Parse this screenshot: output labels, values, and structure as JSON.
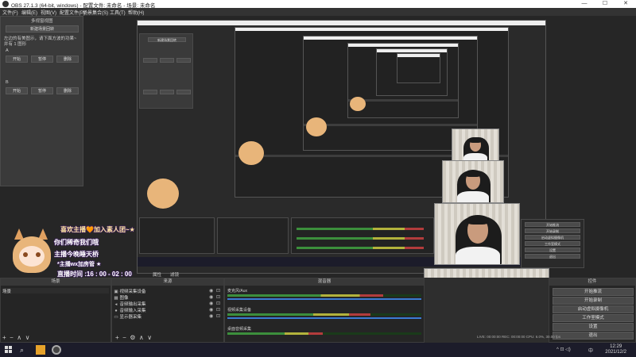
{
  "window": {
    "title": "OBS 27.1.3 (64-bit, windows) - 配置文件: 未命名 - 场景: 未命名",
    "controls": {
      "minimize": "—",
      "maximize": "☐",
      "close": "✕"
    }
  },
  "menu": [
    "文件(F)",
    "编辑(E)",
    "视图(V)",
    "配置文件(P)",
    "场景集合(S)",
    "工具(T)",
    "帮助(H)"
  ],
  "left_panel": {
    "header": "多视窗视图",
    "inner_button": "新建场景回转",
    "info_text": "左边的有美图示，请下面方波的功果~",
    "info_text2": "并有 1 图形",
    "section1": "A",
    "section2": "B",
    "row_buttons": [
      "开始",
      "暂停",
      "删除"
    ]
  },
  "overlay": {
    "line1": "喜欢主播🧡加入素人团~★",
    "line2": "你们稀奇我们哦",
    "line3": "主播今晚睡天桥",
    "line4": "*主播wx加房管 ★",
    "timer": "直播时间 :16 : 00 - 02 : 00"
  },
  "docks": {
    "scenes": {
      "header": "场景",
      "items": [
        "场景"
      ]
    },
    "sources": {
      "header": "来源",
      "items": [
        {
          "icon": "▣",
          "name": "视频采集设备"
        },
        {
          "icon": "▦",
          "name": "图像"
        },
        {
          "icon": "◂",
          "name": "音频输出采集"
        },
        {
          "icon": "●",
          "name": "音频输入采集"
        },
        {
          "icon": "▭",
          "name": "显示器采集"
        }
      ]
    },
    "mixer": {
      "header": "混音器",
      "channels": [
        {
          "name": "麦克风/Aux",
          "db": "0.0 dB"
        },
        {
          "name": "视频采集设备",
          "db": "0.0 dB"
        },
        {
          "name": "桌面音频采集",
          "db": "0.0 dB"
        }
      ]
    },
    "controls": {
      "header": "控件",
      "buttons": [
        "开始推流",
        "开始录制",
        "启动虚拟摄像机",
        "工作室模式",
        "设置",
        "退出"
      ]
    },
    "toolbar_symbols": [
      "+",
      "−",
      "∧",
      "∨"
    ],
    "source_toolbar_symbols": [
      "+",
      "−",
      "⚙",
      "∧",
      "∨"
    ]
  },
  "preview_controls": {
    "left": "属性",
    "right": "滤镜"
  },
  "status": {
    "text": "LIVE: 00:00:00  REC: 00:00:00  CPU: 6.0%, 30.00 fps"
  },
  "taskbar": {
    "time": "12:29",
    "date": "2021/12/2",
    "lang": "中",
    "tray": "^ ⊡ ◁)"
  },
  "colors": {
    "accent": "#3b7bd4",
    "meter_green": "#3c8f3c",
    "meter_yellow": "#b3b33c",
    "meter_red": "#b33c3c",
    "overlay_purple": "#3a1e5a"
  }
}
